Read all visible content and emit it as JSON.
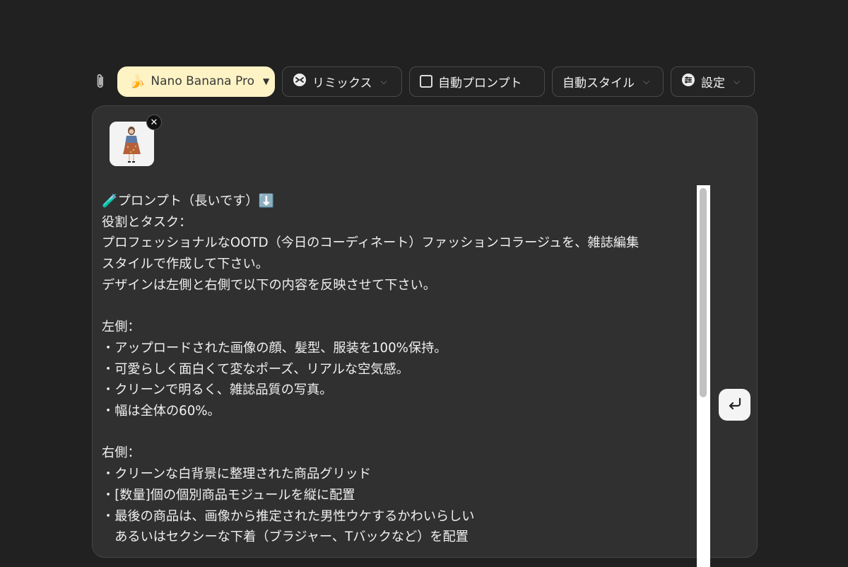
{
  "toolbar": {
    "model_label": "Nano Banana Pro",
    "model_icon": "banana-emoji",
    "remix_label": "リミックス",
    "auto_prompt_label": "自動プロンプト",
    "auto_prompt_checked": false,
    "auto_style_label": "自動スタイル",
    "settings_label": "設定"
  },
  "composer": {
    "prompt_lines": [
      "🧪プロンプト（長いです）⬇️",
      "役割とタスク：",
      "プロフェッショナルなOOTD（今日のコーディネート）ファッションコラージュを、雑誌編集",
      "スタイルで作成して下さい。",
      "デザインは左側と右側で以下の内容を反映させて下さい。",
      "",
      "左側：",
      "・アップロードされた画像の顔、髪型、服装を100%保持。",
      "・可愛らしく面白くて変なポーズ、リアルな空気感。",
      "・クリーンで明るく、雑誌品質の写真。",
      "・幅は全体の60%。",
      "",
      "右側：",
      "・クリーンな白背景に整理された商品グリッド",
      "・[数量]個の個別商品モジュールを縦に配置",
      "・最後の商品は、画像から推定された男性ウケするかわいらしい",
      "　あるいはセクシーな下着（ブラジャー、Tバックなど）を配置"
    ],
    "scroll_position": 0.0
  }
}
